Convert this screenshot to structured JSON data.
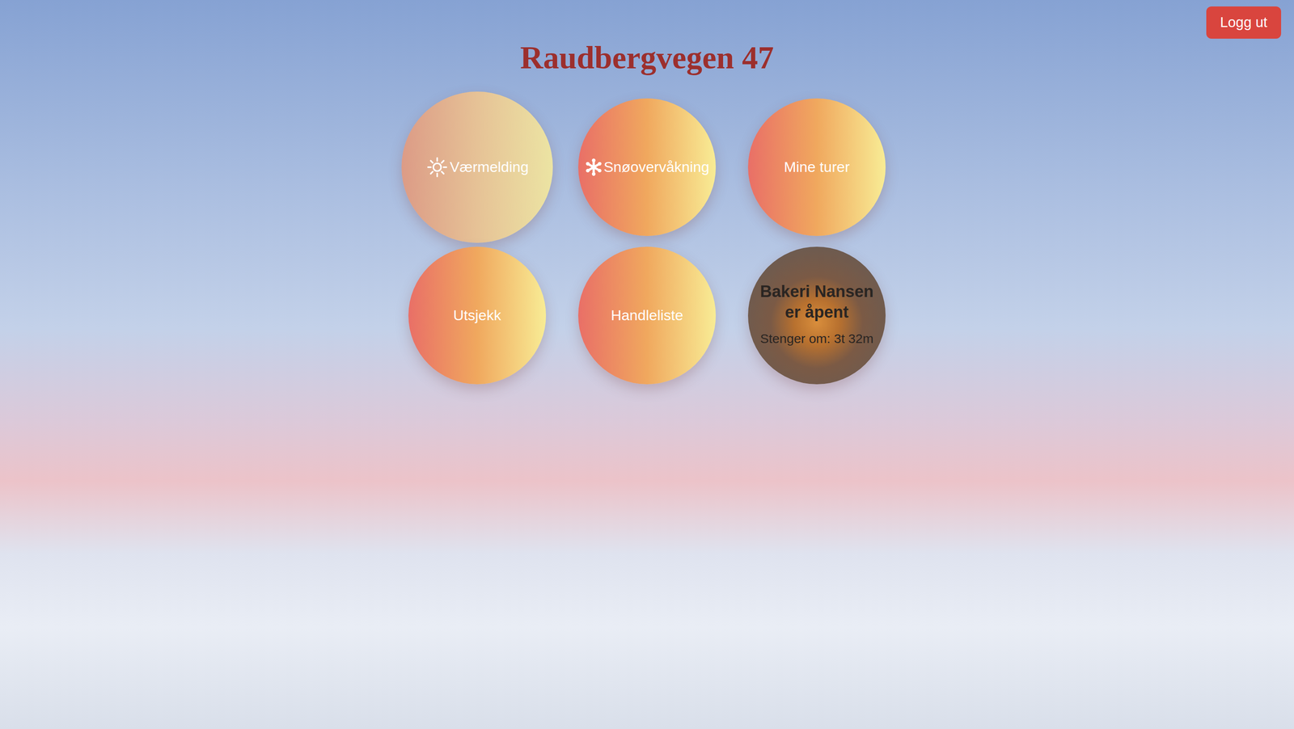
{
  "header": {
    "title": "Raudbergvegen 47"
  },
  "logout_button": "Logg ut",
  "tiles": [
    {
      "kind": "weather",
      "label": "Værmelding",
      "hovered": true
    },
    {
      "kind": "snow",
      "label": "Snøovervåkning",
      "hovered": false
    },
    {
      "kind": "plain",
      "label": "Mine turer",
      "hovered": false
    },
    {
      "kind": "plain",
      "label": "Utsjekk",
      "hovered": false
    },
    {
      "kind": "plain",
      "label": "Handleliste",
      "hovered": false
    },
    {
      "kind": "bakery",
      "title": "Bakeri Nansen er åpent",
      "detail": "Stenger om: 3t 32m",
      "hovered": false
    }
  ]
}
